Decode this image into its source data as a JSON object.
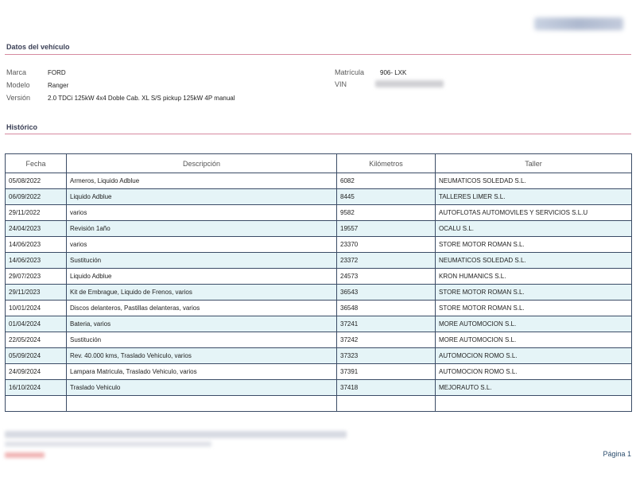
{
  "vehicle_section": {
    "title": "Datos del vehículo",
    "marca_label": "Marca",
    "marca_value": "FORD",
    "modelo_label": "Modelo",
    "modelo_value": "Ranger",
    "version_label": "Versión",
    "version_value": "2.0 TDCi 125kW 4x4 Doble Cab. XL S/S pickup 125kW 4P manual",
    "matricula_label": "Matrícula",
    "matricula_value": "906- LXK",
    "vin_label": "VIN"
  },
  "history_section": {
    "title": "Histórico",
    "columns": [
      "Fecha",
      "Descripción",
      "Kilómetros",
      "Taller"
    ],
    "rows": [
      {
        "fecha": "05/08/2022",
        "descripcion": "Armeros, Liquido Adblue",
        "km": "6082",
        "taller": "NEUMATICOS SOLEDAD S.L."
      },
      {
        "fecha": "06/09/2022",
        "descripcion": "Liquido Adblue",
        "km": "8445",
        "taller": "TALLERES LIMER S.L."
      },
      {
        "fecha": "29/11/2022",
        "descripcion": "varios",
        "km": "9582",
        "taller": "AUTOFLOTAS AUTOMOVILES Y SERVICIOS S.L.U"
      },
      {
        "fecha": "24/04/2023",
        "descripcion": "Revisión 1año",
        "km": "19557",
        "taller": "OCALU S.L."
      },
      {
        "fecha": "14/06/2023",
        "descripcion": "varios",
        "km": "23370",
        "taller": "STORE MOTOR ROMAN S.L."
      },
      {
        "fecha": "14/06/2023",
        "descripcion": "Sustitución",
        "km": "23372",
        "taller": "NEUMATICOS SOLEDAD S.L."
      },
      {
        "fecha": "29/07/2023",
        "descripcion": "Liquido Adblue",
        "km": "24573",
        "taller": "KRON HUMANICS S.L."
      },
      {
        "fecha": "29/11/2023",
        "descripcion": "Kit de Embrague, Liquido de Frenos, varios",
        "km": "36543",
        "taller": "STORE MOTOR ROMAN S.L."
      },
      {
        "fecha": "10/01/2024",
        "descripcion": "Discos delanteros, Pastillas delanteras, varios",
        "km": "36548",
        "taller": "STORE MOTOR ROMAN S.L."
      },
      {
        "fecha": "01/04/2024",
        "descripcion": "Bateria, varios",
        "km": "37241",
        "taller": "MORE AUTOMOCION S.L."
      },
      {
        "fecha": "22/05/2024",
        "descripcion": "Sustitución",
        "km": "37242",
        "taller": "MORE AUTOMOCION S.L."
      },
      {
        "fecha": "05/09/2024",
        "descripcion": "Rev. 40.000 kms, Traslado Vehiculo, varios",
        "km": "37323",
        "taller": "AUTOMOCION ROMO S.L."
      },
      {
        "fecha": "24/09/2024",
        "descripcion": "Lampara Matricula, Traslado Vehiculo, varios",
        "km": "37391",
        "taller": "AUTOMOCION ROMO S.L."
      },
      {
        "fecha": "16/10/2024",
        "descripcion": "Traslado Vehiculo",
        "km": "37418",
        "taller": "MEJORAUTO S.L."
      }
    ]
  },
  "footer": {
    "page_label": "Página 1"
  }
}
